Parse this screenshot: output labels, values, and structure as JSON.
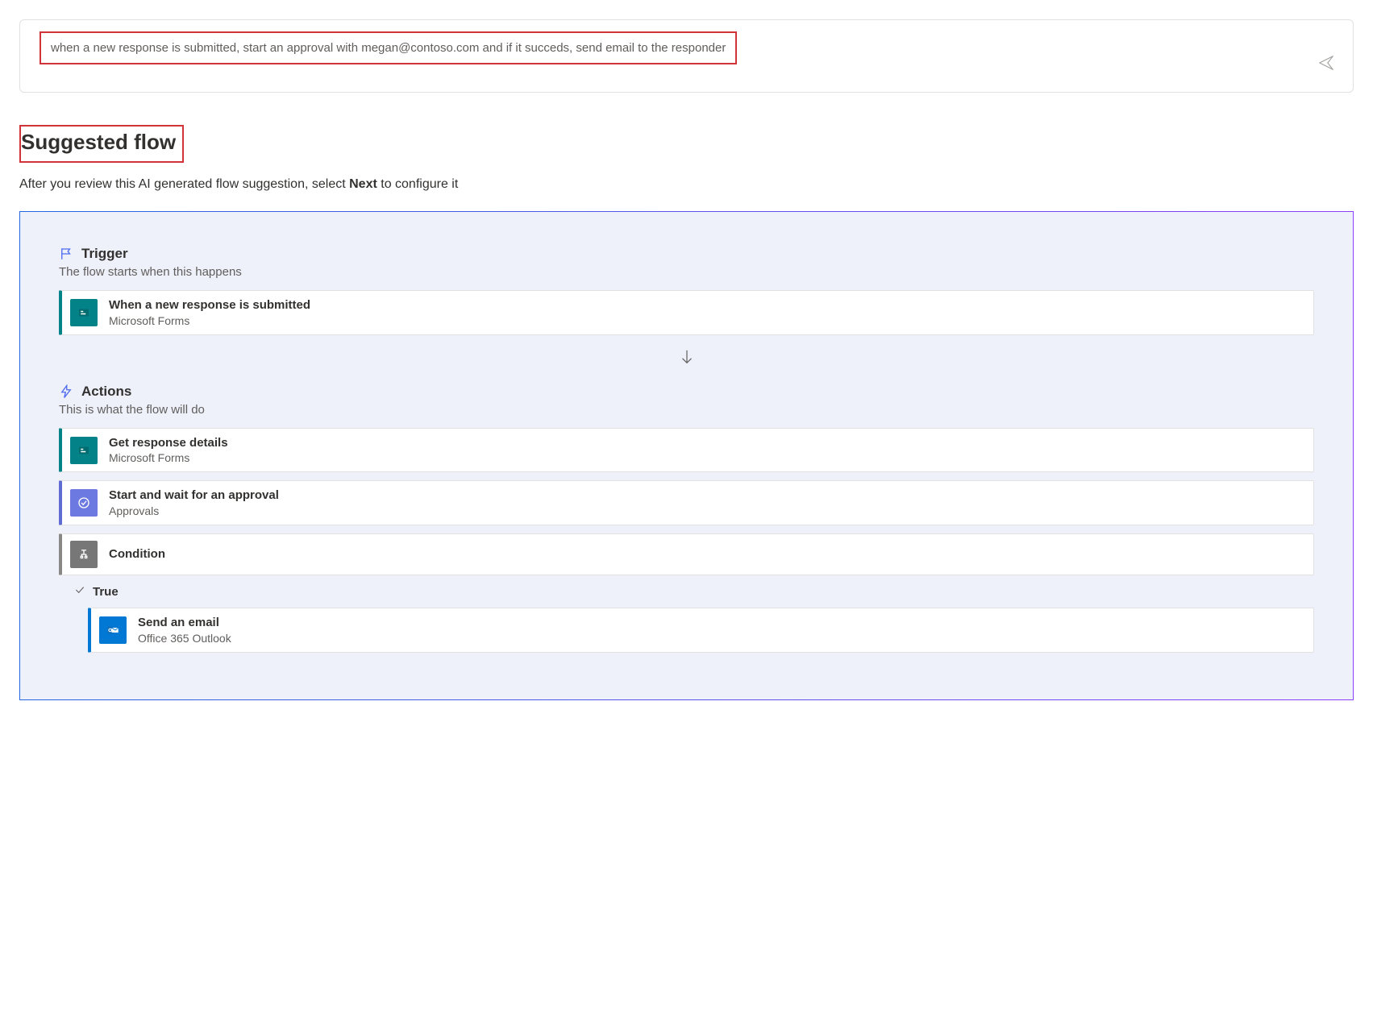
{
  "prompt": {
    "text": "when a new response is submitted, start an approval with megan@contoso.com and if it succeds, send email to the responder"
  },
  "suggested": {
    "heading": "Suggested flow",
    "subtext_before": "After you review this AI generated flow suggestion, select ",
    "subtext_bold": "Next",
    "subtext_after": " to configure it"
  },
  "trigger_section": {
    "title": "Trigger",
    "desc": "The flow starts when this happens",
    "card": {
      "title": "When a new response is submitted",
      "subtitle": "Microsoft Forms"
    }
  },
  "actions_section": {
    "title": "Actions",
    "desc": "This is what the flow will do",
    "cards": [
      {
        "title": "Get response details",
        "subtitle": "Microsoft Forms"
      },
      {
        "title": "Start and wait for an approval",
        "subtitle": "Approvals"
      },
      {
        "title": "Condition",
        "subtitle": ""
      }
    ],
    "branch": {
      "label": "True",
      "card": {
        "title": "Send an email",
        "subtitle": "Office 365 Outlook"
      }
    }
  },
  "colors": {
    "highlight_border": "#d13438",
    "teal": "#038387",
    "indigo": "#5f6cd1",
    "gray": "#777777",
    "blue": "#0078d4"
  }
}
